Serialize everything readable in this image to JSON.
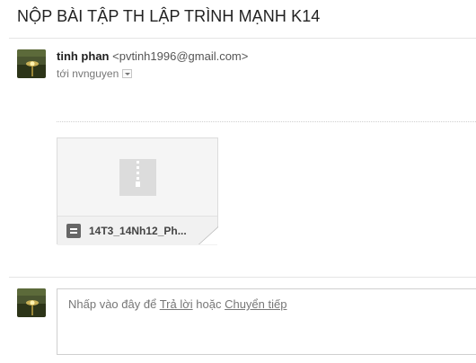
{
  "email": {
    "subject": "NỘP BÀI TẬP TH LẬP TRÌNH MẠNH K14",
    "sender_name": "tinh phan",
    "sender_email": "<pvtinh1996@gmail.com>",
    "recipient_text": "tới nvnguyen"
  },
  "attachment": {
    "file_name": "14T3_14Nh12_Ph..."
  },
  "reply": {
    "prefix": "Nhấp vào đây để",
    "reply_link": "Trả lời",
    "or_text": "hoặc",
    "forward_link": "Chuyển tiếp"
  },
  "icons": {
    "avatar": "sunset-photo",
    "recipient_details": "chevron-down-icon",
    "attachment_preview": "zip-file-icon",
    "attachment_type": "document-icon"
  }
}
